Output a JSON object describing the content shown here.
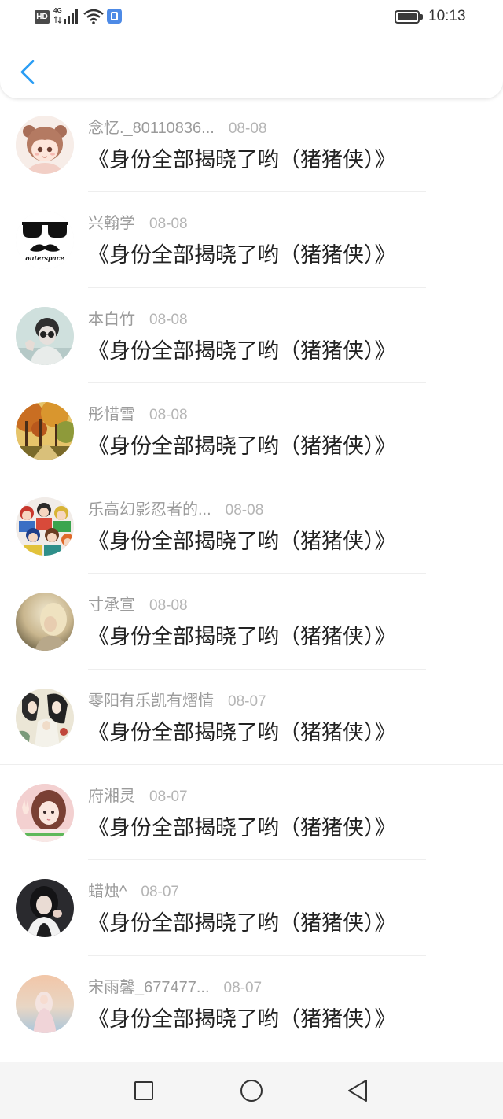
{
  "status_bar": {
    "hd_badge": "HD",
    "network_type": "4G",
    "time": "10:13",
    "icons": [
      "signal-bars-icon",
      "wifi-icon",
      "app-notification-icon",
      "battery-icon"
    ]
  },
  "header": {
    "back_icon": "chevron-left-icon"
  },
  "list": {
    "items": [
      {
        "name": "念忆._80110836...",
        "date": "08-08",
        "title": "《身份全部揭晓了哟（猪猪侠）》"
      },
      {
        "name": "兴翰学",
        "date": "08-08",
        "title": "《身份全部揭晓了哟（猪猪侠）》",
        "avatar_caption": "outerspace"
      },
      {
        "name": "本白竹",
        "date": "08-08",
        "title": "《身份全部揭晓了哟（猪猪侠）》"
      },
      {
        "name": "彤惜雪",
        "date": "08-08",
        "title": "《身份全部揭晓了哟（猪猪侠）》"
      },
      {
        "name": "乐高幻影忍者的...",
        "date": "08-08",
        "title": "《身份全部揭晓了哟（猪猪侠）》"
      },
      {
        "name": "寸承宣",
        "date": "08-08",
        "title": "《身份全部揭晓了哟（猪猪侠）》"
      },
      {
        "name": "零阳有乐凯有熠情",
        "date": "08-07",
        "title": "《身份全部揭晓了哟（猪猪侠）》"
      },
      {
        "name": "府湘灵",
        "date": "08-07",
        "title": "《身份全部揭晓了哟（猪猪侠）》"
      },
      {
        "name": "蜡烛^",
        "date": "08-07",
        "title": "《身份全部揭晓了哟（猪猪侠）》"
      },
      {
        "name": "宋雨馨_677477...",
        "date": "08-07",
        "title": "《身份全部揭晓了哟（猪猪侠）》"
      }
    ]
  },
  "nav_bar": {
    "icons": [
      "square-recents-icon",
      "circle-home-icon",
      "triangle-back-icon"
    ]
  },
  "colors": {
    "accent": "#2a9df4",
    "name_text": "#9b9b9b",
    "date_text": "#b5b5b5",
    "title_text": "#222222",
    "nav_bar_bg": "#f5f5f5"
  }
}
